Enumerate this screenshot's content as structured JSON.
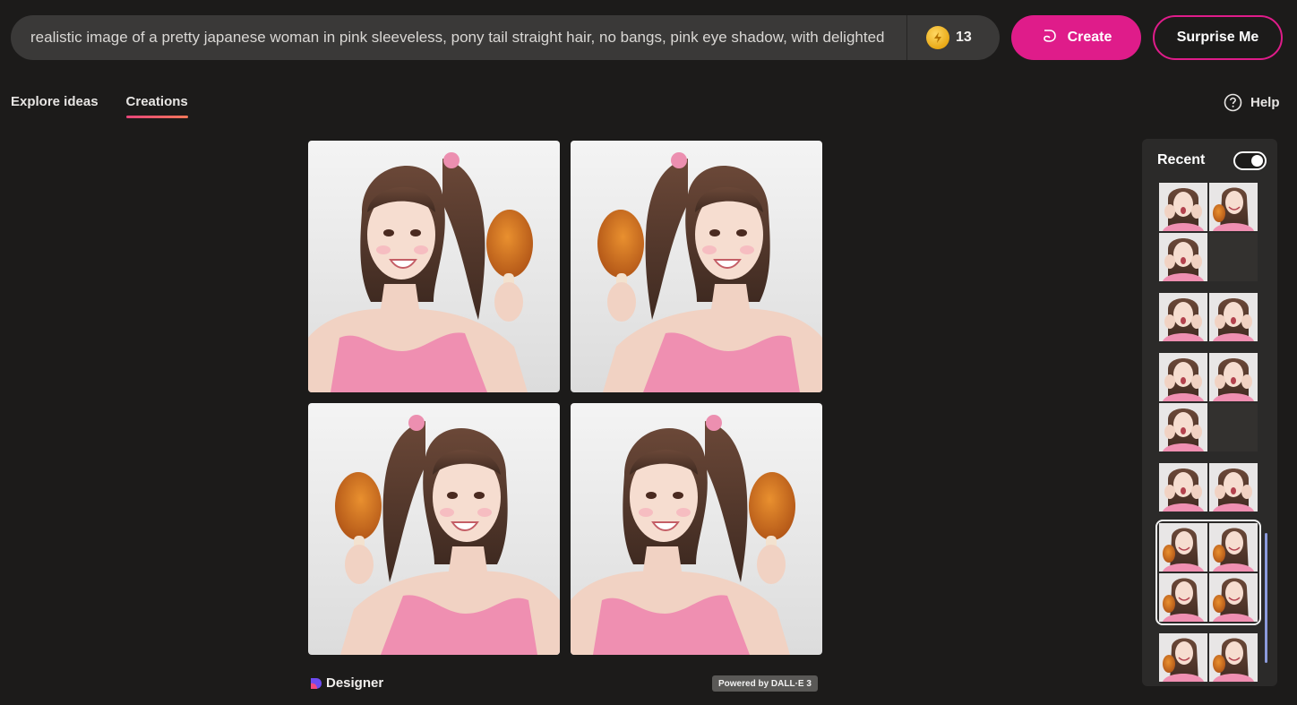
{
  "prompt": {
    "text": "realistic image of a pretty japanese woman in pink sleeveless, pony tail straight hair, no bangs, pink eye shadow, with delighted"
  },
  "boosts": {
    "count": "13"
  },
  "buttons": {
    "create": "Create",
    "surprise": "Surprise Me"
  },
  "tabs": [
    {
      "label": "Explore ideas",
      "active": false
    },
    {
      "label": "Creations",
      "active": true
    }
  ],
  "help": {
    "label": "Help"
  },
  "footer": {
    "brand": "Designer",
    "powered": "Powered by DALL·E 3"
  },
  "recent": {
    "title": "Recent",
    "toggle_on": true
  },
  "colors": {
    "accent": "#df1c8a",
    "background": "#1c1b1a",
    "panel": "#2b2a29"
  }
}
